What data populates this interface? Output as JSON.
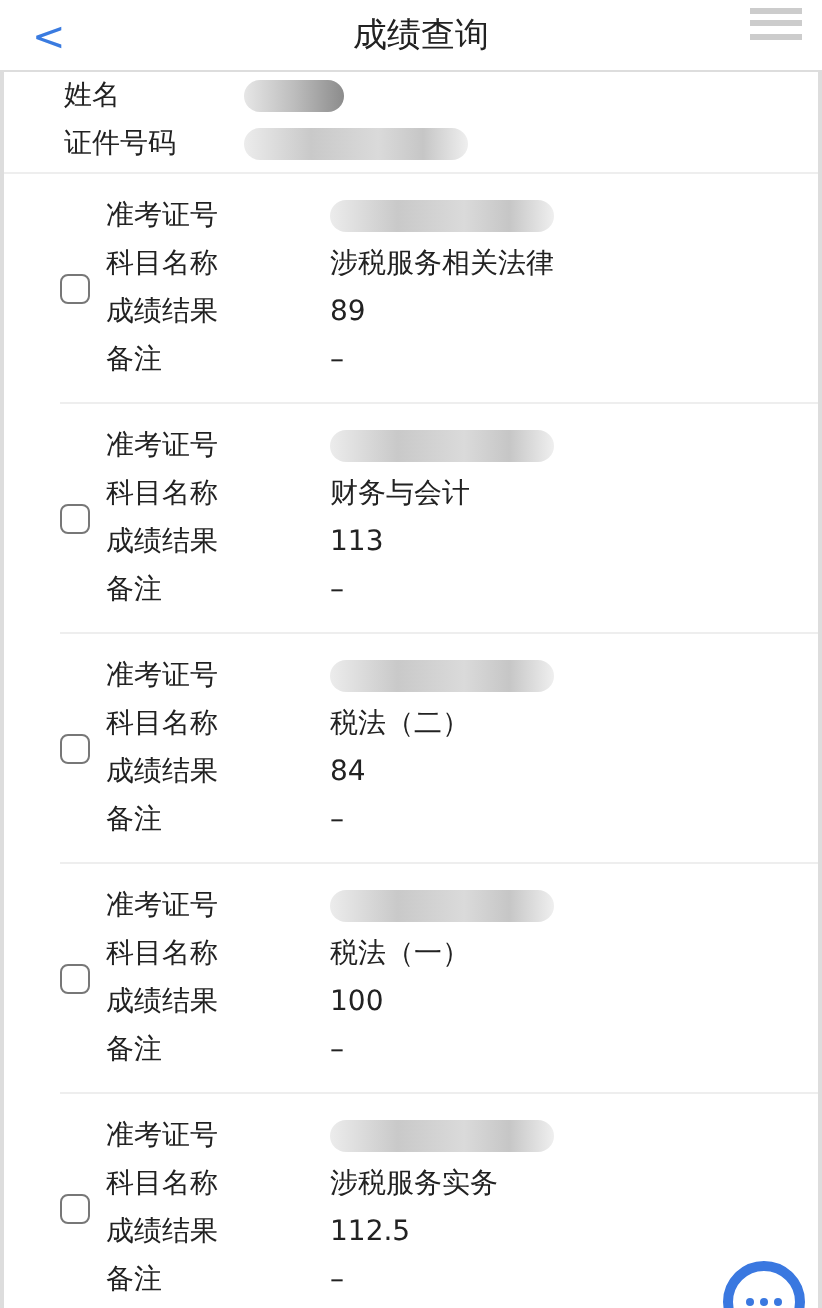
{
  "header": {
    "back": "<",
    "title": "成绩查询"
  },
  "profile": [
    {
      "label": "姓名",
      "redacted": true
    },
    {
      "label": "证件号码",
      "redacted": true
    }
  ],
  "records": [
    {
      "checked": false,
      "fields": [
        {
          "label": "准考证号",
          "redacted": true
        },
        {
          "label": "科目名称",
          "value": "涉税服务相关法律"
        },
        {
          "label": "成绩结果",
          "value": "89"
        },
        {
          "label": "备注",
          "value": "–"
        }
      ]
    },
    {
      "checked": false,
      "fields": [
        {
          "label": "准考证号",
          "redacted": true
        },
        {
          "label": "科目名称",
          "value": "财务与会计"
        },
        {
          "label": "成绩结果",
          "value": "113"
        },
        {
          "label": "备注",
          "value": "–"
        }
      ]
    },
    {
      "checked": false,
      "fields": [
        {
          "label": "准考证号",
          "redacted": true
        },
        {
          "label": "科目名称",
          "value": "税法（二）"
        },
        {
          "label": "成绩结果",
          "value": "84"
        },
        {
          "label": "备注",
          "value": "–"
        }
      ]
    },
    {
      "checked": false,
      "fields": [
        {
          "label": "准考证号",
          "redacted": true
        },
        {
          "label": "科目名称",
          "value": "税法（一）"
        },
        {
          "label": "成绩结果",
          "value": "100"
        },
        {
          "label": "备注",
          "value": "–"
        }
      ]
    },
    {
      "checked": false,
      "fields": [
        {
          "label": "准考证号",
          "redacted": true
        },
        {
          "label": "科目名称",
          "value": "涉税服务实务"
        },
        {
          "label": "成绩结果",
          "value": "112.5"
        },
        {
          "label": "备注",
          "value": "–"
        }
      ]
    }
  ]
}
